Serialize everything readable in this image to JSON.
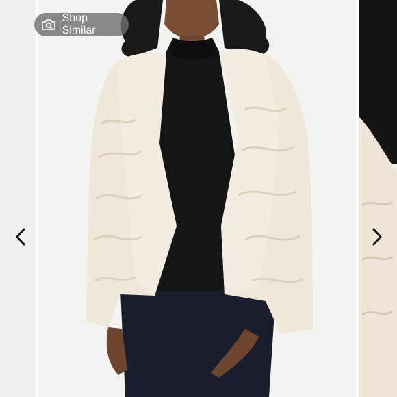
{
  "carousel": {
    "shop_similar": {
      "label": "Shop Similar",
      "icon": "camera-search-icon"
    },
    "prev_icon": "chevron-left-icon",
    "next_icon": "chevron-right-icon",
    "colors": {
      "background": "#f3f3f3",
      "pill": "#707070",
      "coat": "#efe7da",
      "sweater": "#151515",
      "jeans": "#1a1d2b"
    }
  }
}
